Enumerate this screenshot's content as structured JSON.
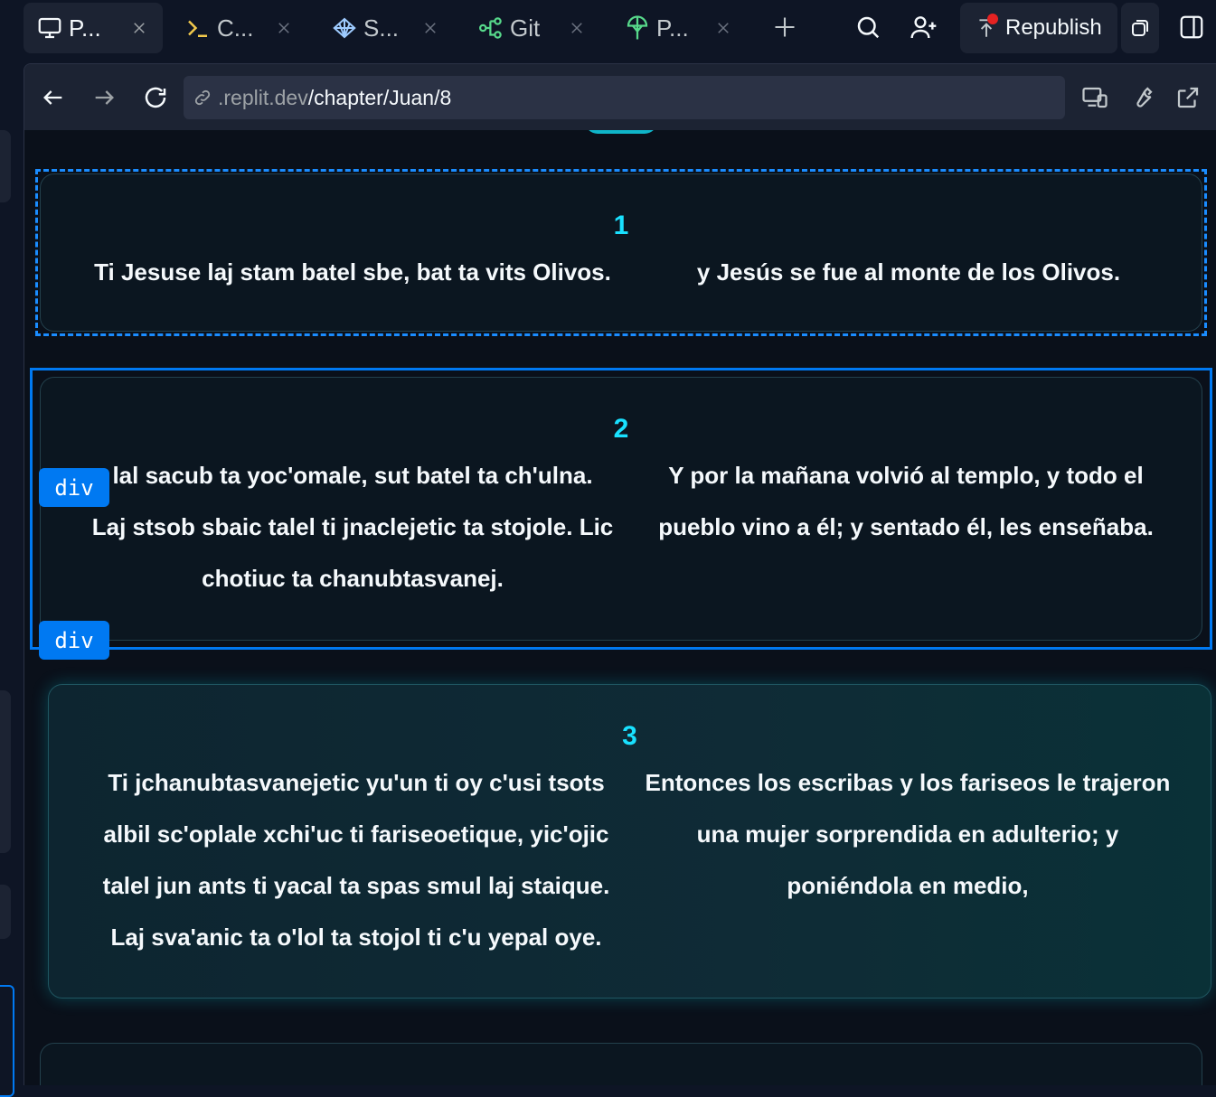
{
  "tabs": [
    {
      "label": "P...",
      "icon": "monitor-icon",
      "active": true
    },
    {
      "label": "C...",
      "icon": "terminal-icon",
      "active": false
    },
    {
      "label": "S...",
      "icon": "shell-icon",
      "active": false
    },
    {
      "label": "Git",
      "icon": "git-branch-icon",
      "active": false
    },
    {
      "label": "P...",
      "icon": "tree-icon",
      "active": false
    }
  ],
  "toolbar": {
    "new_tab_icon": "plus-icon",
    "search_icon": "search-icon",
    "invite_icon": "add-user-icon",
    "republish_label": "Republish",
    "layout_icon": "sidebar-icon"
  },
  "webview": {
    "url_host": ".replit.dev",
    "url_path": "/chapter/Juan/8",
    "devices_icon": "devices-icon",
    "devtools_icon": "wrench-icon",
    "open_external_icon": "external-link-icon"
  },
  "verses": [
    {
      "number": "1",
      "left_lines": [
        "Ti Jesuse laj stam batel sbe, bat ta vits Olivos."
      ],
      "right_lines": [
        "y Jesús se fue al monte de los Olivos."
      ]
    },
    {
      "number": "2",
      "left_lines": [
        "lal sacub ta yoc'omale, sut batel ta ch'ulna.",
        "Laj stsob sbaic talel ti jnaclejetic ta stojole. Lic",
        "chotiuc ta chanubtasvanej."
      ],
      "right_lines": [
        "Y por la mañana volvió al templo, y todo el",
        "pueblo vino a él; y sentado él, les enseñaba."
      ]
    },
    {
      "number": "3",
      "left_lines": [
        "Ti jchanubtasvanejetic yu'un ti oy c'usi tsots",
        "albil sc'oplale xchi'uc ti fariseoetique, yic'ojic",
        "talel jun ants ti yacal ta spas smul laj staique.",
        "Laj sva'anic ta o'lol ta stojol ti c'u yepal oye."
      ],
      "right_lines": [
        "Entonces los escribas y los fariseos le trajeron",
        "una mujer sorprendida en adulterio; y",
        "poniéndola en medio,"
      ]
    }
  ],
  "inspector": {
    "tag_label_top": "div",
    "tag_label_bottom": "div",
    "accent_color": "#0079f2"
  },
  "colors": {
    "verse_number": "#19e1ff",
    "background": "#0e1525",
    "card": "#0b1620"
  }
}
